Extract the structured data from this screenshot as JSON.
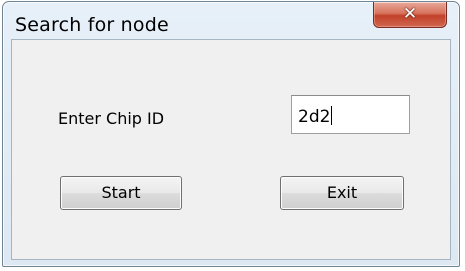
{
  "window": {
    "title": "Search for node",
    "close_icon": "close-icon"
  },
  "form": {
    "chip_id_label": "Enter Chip ID",
    "chip_id_value": "2d2"
  },
  "buttons": {
    "start_label": "Start",
    "exit_label": "Exit"
  },
  "colors": {
    "close_button": "#c2412a",
    "frame": "#dde8f2",
    "client_bg": "#f0f0f0"
  }
}
